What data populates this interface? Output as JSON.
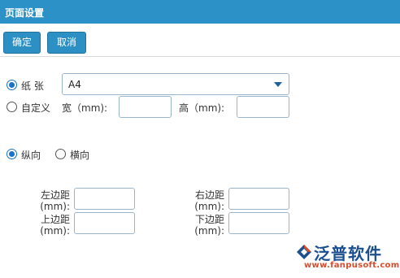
{
  "window": {
    "title": "页面设置"
  },
  "toolbar": {
    "ok_label": "确定",
    "cancel_label": "取消"
  },
  "paper": {
    "paper_label": "纸 张",
    "paper_value": "A4",
    "custom_label": "自定义",
    "width_label": "宽（mm):",
    "height_label": "高（mm):"
  },
  "orientation": {
    "portrait_label": "纵向",
    "landscape_label": "横向"
  },
  "margins": {
    "left_label": "左边距(mm):",
    "right_label": "右边距(mm):",
    "top_label": "上边距(mm):",
    "bottom_label": "下边距(mm):"
  },
  "logo": {
    "name": "泛普软件",
    "url": "www.fanpusoft.com"
  }
}
